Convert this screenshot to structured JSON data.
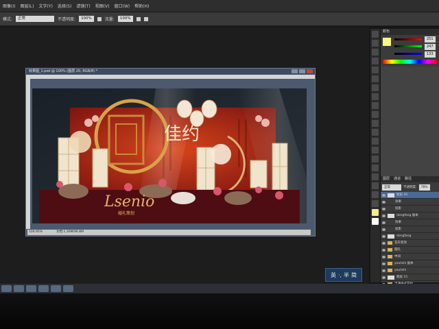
{
  "menubar": {
    "items": [
      "图像(I)",
      "图层(L)",
      "文字(Y)",
      "选择(S)",
      "滤镜(T)",
      "视图(V)",
      "窗口(W)",
      "帮助(H)"
    ]
  },
  "options": {
    "mode_label": "模式:",
    "mode_value": "正常",
    "opacity_label": "不透明度:",
    "opacity_value": "100%",
    "flow_label": "流量:",
    "flow_value": "100%"
  },
  "document": {
    "title": "效果图_1.psd @ 100% (图层 20, RGB/8) *",
    "zoom": "100.95%",
    "doc_info": "文档:1.26M/96.8M"
  },
  "artwork": {
    "logo_text": "Lsenio",
    "logo_subtext": "婚礼策划",
    "calligraphy": "佳约"
  },
  "color_panel": {
    "tab": "颜色",
    "r": "251",
    "g": "247",
    "b": "133"
  },
  "layers_panel": {
    "tabs": [
      "图层",
      "通道",
      "路径"
    ],
    "blend": "正常",
    "opacity_label": "不透明度:",
    "opacity_value": "78%",
    "layers": [
      {
        "name": "图层 20",
        "type": "layer",
        "selected": true
      },
      {
        "name": "效果",
        "type": "effect"
      },
      {
        "name": "投影",
        "type": "effect"
      },
      {
        "name": "dongfang 副本",
        "type": "layer"
      },
      {
        "name": "效果",
        "type": "effect"
      },
      {
        "name": "投影",
        "type": "effect"
      },
      {
        "name": "dongfang",
        "type": "layer"
      },
      {
        "name": "花卉装饰",
        "type": "folder"
      },
      {
        "name": "圆孔",
        "type": "folder"
      },
      {
        "name": "中间",
        "type": "folder"
      },
      {
        "name": "youlishi 副本",
        "type": "folder"
      },
      {
        "name": "youlishi",
        "type": "folder"
      },
      {
        "name": "图层 15",
        "type": "layer"
      },
      {
        "name": "卡通中式花纹",
        "type": "folder"
      }
    ]
  },
  "ime": {
    "lang": "英",
    "punct": "·,",
    "width": "半",
    "script": "简"
  }
}
